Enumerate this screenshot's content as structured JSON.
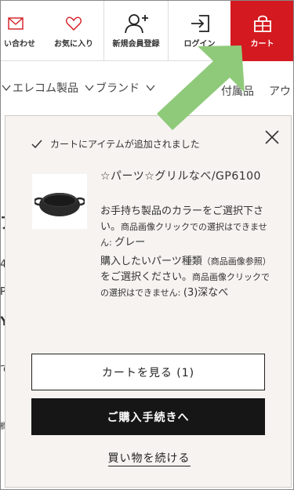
{
  "header": {
    "contact_label": "い合わせ",
    "favorites_label": "お気に入り",
    "register_label": "新規会員登録",
    "login_label": "ログイン",
    "cart_label": "カート",
    "cart_color": "#d41920"
  },
  "catnav": {
    "items": [
      "エレコム製品",
      "ブランド"
    ],
    "accessory": "付属品",
    "outlet": "アウ"
  },
  "background_fragments": [
    "ア",
    "4",
    "P",
    "Y",
    "で",
    "欄"
  ],
  "modal": {
    "added_message": "カートにアイテムが追加されました",
    "product_name": "☆パーツ☆グリルなべ/GP6100",
    "option1_main": "お手持ち製品のカラーをご選択下さい。",
    "option1_small": "商品画像クリックでの選択はできません: ",
    "option1_value": "グレー",
    "option2_main": "購入したいパーツ種類",
    "option2_small_a": "（商品画像参照）",
    "option2_mid": "をご選択ください。",
    "option2_small_b": "商品画像クリックでの選択はできません: ",
    "option2_value": "(3)深なべ",
    "view_cart_label": "カートを見る (1)",
    "checkout_label": "ご購入手続きへ",
    "continue_label": "買い物を続ける"
  },
  "colors": {
    "arrow": "#8fca7a",
    "modal_bg": "#f6f3f0",
    "checkout_bg": "#161616"
  }
}
